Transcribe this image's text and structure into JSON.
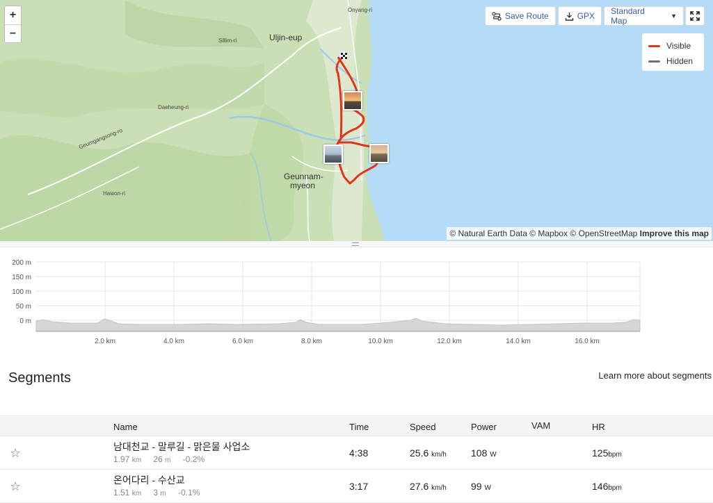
{
  "map": {
    "zoom_in": "+",
    "zoom_out": "−",
    "save_route": "Save Route",
    "gpx": "GPX",
    "map_style": "Standard Map",
    "legend": {
      "visible": "Visible",
      "hidden": "Hidden"
    },
    "attribution": {
      "text": "© Natural Earth Data © Mapbox © OpenStreetMap",
      "improve": "Improve this map"
    },
    "labels": {
      "onyang": "Onyang-ri",
      "uljin": "Uljin-eup",
      "sillim": "Sillim-ri",
      "daeheung": "Daeheung-ri",
      "geumgang": "Geumgangsong-ro",
      "geunnam_1": "Geunnam-",
      "geunnam_2": "myeon",
      "hawon": "Hawon-ri"
    },
    "colors": {
      "route": "#e3341c",
      "hidden": "#707070",
      "water": "#b4dcf6",
      "land": "#c9dcb4"
    }
  },
  "elevation": {
    "y_ticks": [
      "200 m",
      "150 m",
      "100 m",
      "50 m",
      "0 m"
    ],
    "x_ticks": [
      "2.0 km",
      "4.0 km",
      "6.0 km",
      "8.0 km",
      "10.0 km",
      "12.0 km",
      "14.0 km",
      "16.0 km"
    ]
  },
  "segments": {
    "title": "Segments",
    "learn_more": "Learn more about segments",
    "columns": {
      "name": "Name",
      "time": "Time",
      "speed": "Speed",
      "power": "Power",
      "vam": "VAM",
      "hr": "HR"
    },
    "rows": [
      {
        "name": "남대천교 - 말루길 - 맑은물 사업소",
        "distance": "1.97",
        "distance_unit": "km",
        "elev": "26",
        "elev_unit": "m",
        "grade": "-0.2%",
        "time": "4:38",
        "speed": "25.6",
        "speed_unit": "km/h",
        "power": "108",
        "power_unit": "W",
        "vam": "",
        "hr": "125",
        "hr_unit": "bpm"
      },
      {
        "name": "온어다리 - 수산교",
        "distance": "1.51",
        "distance_unit": "km",
        "elev": "3",
        "elev_unit": "m",
        "grade": "-0.1%",
        "time": "3:17",
        "speed": "27.6",
        "speed_unit": "km/h",
        "power": "99",
        "power_unit": "W",
        "vam": "",
        "hr": "146",
        "hr_unit": "bpm"
      }
    ]
  }
}
